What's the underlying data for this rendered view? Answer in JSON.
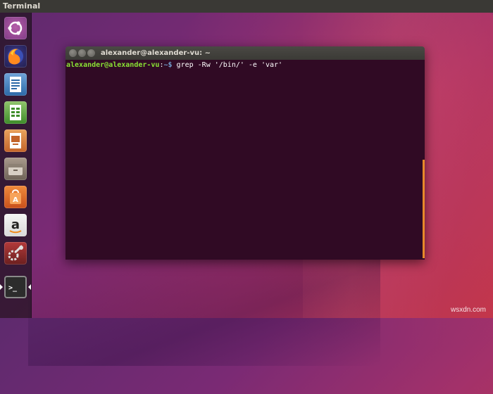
{
  "top_panel": {
    "title": "Terminal"
  },
  "launcher": {
    "items": [
      {
        "name": "ubuntu-dash"
      },
      {
        "name": "firefox"
      },
      {
        "name": "libreoffice-writer"
      },
      {
        "name": "libreoffice-calc"
      },
      {
        "name": "libreoffice-impress"
      },
      {
        "name": "files"
      },
      {
        "name": "ubuntu-software"
      },
      {
        "name": "amazon"
      },
      {
        "name": "system-settings"
      },
      {
        "name": "terminal"
      }
    ],
    "amazon_letter": "a",
    "terminal_glyph": ">_"
  },
  "window": {
    "title": "alexander@alexander-vu: ~",
    "prompt_user": "alexander@alexander-vu",
    "prompt_sep": ":",
    "prompt_path": "~$",
    "command": " grep -Rw '/bin/' -e 'var'"
  },
  "colors": {
    "terminal_bg": "#300a24",
    "prompt_user": "#8ae234",
    "prompt_path": "#729fcf",
    "scrollbar": "#e7892a"
  },
  "watermark": "wsxdn.com"
}
